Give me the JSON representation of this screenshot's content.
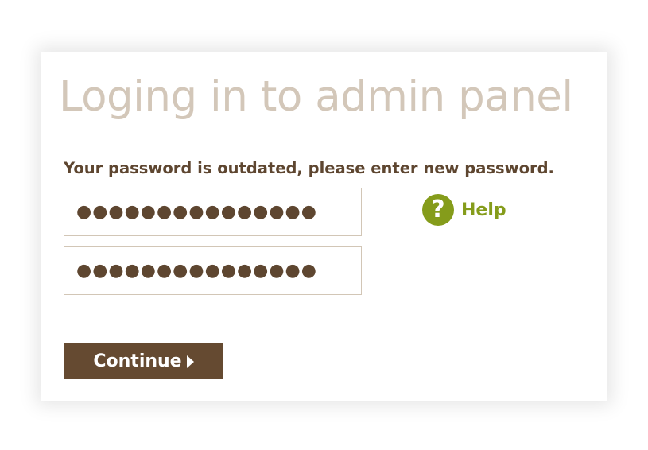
{
  "page": {
    "title": "Loging in to admin panel",
    "message": "Your password is outdated, please enter new password."
  },
  "form": {
    "new_password_value": "●●●●●●●●●●●●●●●",
    "confirm_password_value": "●●●●●●●●●●●●●●●",
    "continue_label": "Continue"
  },
  "help": {
    "icon_glyph": "?",
    "label": "Help",
    "icon": "help-circle-icon"
  },
  "colors": {
    "title": "#d3c7b9",
    "text": "#5e4630",
    "accent_green": "#859c1b",
    "button_bg": "#654a31",
    "field_border": "#d2c6b6"
  }
}
